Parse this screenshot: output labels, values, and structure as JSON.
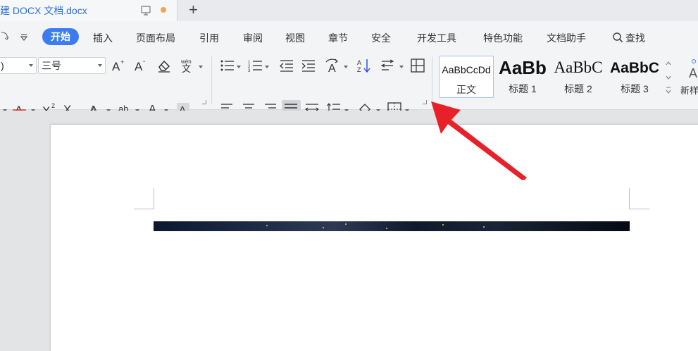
{
  "titlebar": {
    "tab_title": "建 DOCX 文档.docx",
    "new_tab_label": "+"
  },
  "menu": {
    "start": "开始",
    "items": [
      "插入",
      "页面布局",
      "引用",
      "审阅",
      "视图",
      "章节",
      "安全",
      "开发工具",
      "特色功能",
      "文档助手"
    ],
    "search": "查找"
  },
  "font": {
    "family_value": ")",
    "size_value": "三号"
  },
  "styles": {
    "items": [
      {
        "preview": "AaBbCcDd",
        "caption": "正文"
      },
      {
        "preview": "AaBb",
        "caption": "标题 1"
      },
      {
        "preview": "AaBbC",
        "caption": "标题 2"
      },
      {
        "preview": "AaBbC",
        "caption": "标题 3"
      }
    ],
    "new_style_label": "新样"
  },
  "colors": {
    "accent": "#3b7cf0",
    "tab_title": "#2f6fd6",
    "highlight": "#f7e733",
    "font_color": "#1a4fd6",
    "arrow": "#e8202a"
  },
  "icons": [
    "redo-icon",
    "quick-access-more-icon",
    "search-icon",
    "monitor-icon",
    "grow-font-icon",
    "shrink-font-icon",
    "clear-format-icon",
    "phonetic-icon",
    "bullets-icon",
    "numbering-icon",
    "outdent-icon",
    "indent-icon",
    "text-direction-icon",
    "sort-icon",
    "line-spacing-icon",
    "table-icon",
    "strikethrough-icon",
    "superscript-icon",
    "subscript-icon",
    "text-effect-icon",
    "highlight-icon",
    "font-color-icon",
    "char-shading-icon",
    "align-left-icon",
    "align-center-icon",
    "align-right-icon",
    "justify-icon",
    "distribute-icon",
    "paragraph-spacing-icon",
    "shading-icon",
    "borders-icon",
    "dialog-launcher-icon"
  ]
}
